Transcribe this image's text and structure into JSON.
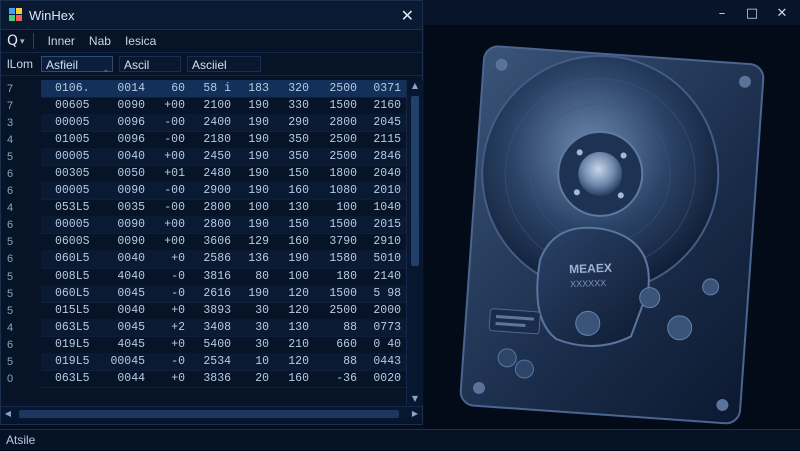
{
  "app": {
    "title": "WinHex",
    "close_glyph": "✕",
    "accent": "#12305a"
  },
  "outer": {
    "minimize": "–",
    "maximize": "□",
    "close": "✕"
  },
  "toolbar": {
    "tool_glyph": "Q",
    "caret": "▾",
    "items": [
      "Inner",
      "Nab",
      "Iesica"
    ]
  },
  "columns": {
    "label": "lLom",
    "field1": "Asfieil",
    "field1_caret": "‸",
    "field2": "Ascil",
    "field3": "Asciiel"
  },
  "table": {
    "rows": [
      {
        "rn": "7",
        "c": [
          "0106.",
          "0014",
          "60",
          "58 i",
          "183",
          "320",
          "2500",
          "0371"
        ]
      },
      {
        "rn": "7",
        "c": [
          "00605",
          "0090",
          "+00",
          "2100",
          "190",
          "330",
          "1500",
          "2160"
        ]
      },
      {
        "rn": "3",
        "c": [
          "00005",
          "0096",
          "-00",
          "2400",
          "190",
          "290",
          "2800",
          "2045"
        ]
      },
      {
        "rn": "4",
        "c": [
          "01005",
          "0096",
          "-00",
          "2180",
          "190",
          "350",
          "2500",
          "2115"
        ]
      },
      {
        "rn": "5",
        "c": [
          "00005",
          "0040",
          "+00",
          "2450",
          "190",
          "350",
          "2500",
          "2846"
        ]
      },
      {
        "rn": "6",
        "c": [
          "00305",
          "0050",
          "+01",
          "2480",
          "190",
          "150",
          "1800",
          "2040"
        ]
      },
      {
        "rn": "6",
        "c": [
          "00005",
          "0090",
          "-00",
          "2900",
          "190",
          "160",
          "1080",
          "2010"
        ]
      },
      {
        "rn": "4",
        "c": [
          "053L5",
          "0035",
          "-00",
          "2800",
          "100",
          "130",
          "100",
          "1040"
        ]
      },
      {
        "rn": "6",
        "c": [
          "00005",
          "0090",
          "+00",
          "2800",
          "190",
          "150",
          "1500",
          "2015"
        ]
      },
      {
        "rn": "5",
        "c": [
          "0600S",
          "0090",
          "+00",
          "3606",
          "129",
          "160",
          "3790",
          "2910"
        ]
      },
      {
        "rn": "6",
        "c": [
          "060L5",
          "0040",
          "+0",
          "2586",
          "136",
          "190",
          "1580",
          "5010"
        ]
      },
      {
        "rn": "5",
        "c": [
          "008L5",
          "4040",
          "-0",
          "3816",
          "80",
          "100",
          "180",
          "2140"
        ]
      },
      {
        "rn": "5",
        "c": [
          "060L5",
          "0045",
          "-0",
          "2616",
          "190",
          "120",
          "1500",
          "5 98"
        ]
      },
      {
        "rn": "5",
        "c": [
          "015L5",
          "0040",
          "+0",
          "3893",
          "30",
          "120",
          "2500",
          "2000"
        ]
      },
      {
        "rn": "4",
        "c": [
          "063L5",
          "0045",
          "+2",
          "3408",
          "30",
          "130",
          "88",
          "0773"
        ]
      },
      {
        "rn": "6",
        "c": [
          "019L5",
          "4045",
          "+0",
          "5400",
          "30",
          "210",
          "660",
          "0 40"
        ]
      },
      {
        "rn": "5",
        "c": [
          "019L5",
          "00045",
          "-0",
          "2534",
          "10",
          "120",
          "88",
          "0443"
        ]
      },
      {
        "rn": "0",
        "c": [
          "063L5",
          "0044",
          "+0",
          "3836",
          "20",
          "160",
          "-36",
          "0020"
        ]
      }
    ]
  },
  "scroll": {
    "up": "▲",
    "down": "▼",
    "left": "◀",
    "right": "▶"
  },
  "status": {
    "text": "Atsile"
  }
}
